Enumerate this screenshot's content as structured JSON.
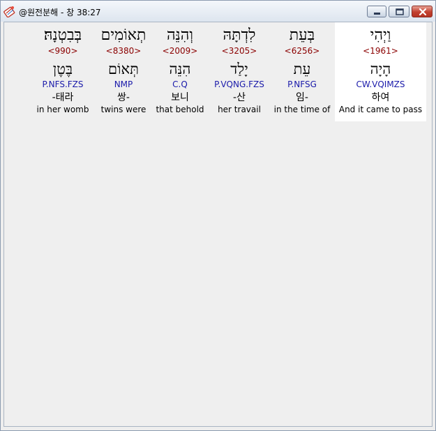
{
  "window": {
    "title": "@원전분해 - 창 38:27",
    "app_icon": "bible-app-icon"
  },
  "words": [
    {
      "hebrew": "וַיְהִי",
      "strong": "<1961>",
      "lemma": "הָיָה",
      "parse": "CW.VQIMZS",
      "korean": "하여",
      "english": "And it came to pass",
      "selected": true
    },
    {
      "hebrew": "בְּעֵת",
      "strong": "<6256>",
      "lemma": "עֵת",
      "parse": "P.NFSG",
      "korean": "임-",
      "english": "in the time of",
      "selected": false
    },
    {
      "hebrew": "לִדְתָּהּ",
      "strong": "<3205>",
      "lemma": "יָלַד",
      "parse": "P.VQNG.FZS",
      "korean": "-산",
      "english": "her travail",
      "selected": false
    },
    {
      "hebrew": "וְהִנֵּה",
      "strong": "<2009>",
      "lemma": "הִנֵּה",
      "parse": "C.Q",
      "korean": "보니",
      "english": "that behold",
      "selected": false
    },
    {
      "hebrew": "תְאוֹמִים",
      "strong": "<8380>",
      "lemma": "תְּאוֹם",
      "parse": "NMP",
      "korean": "쌍-",
      "english": "twins were",
      "selected": false
    },
    {
      "hebrew": "בְּבִטְנָהּ׃",
      "strong": "<990>",
      "lemma": "בֶּטֶן",
      "parse": "P.NFS.FZS",
      "korean": "-태라",
      "english": "in her womb",
      "selected": false
    }
  ]
}
